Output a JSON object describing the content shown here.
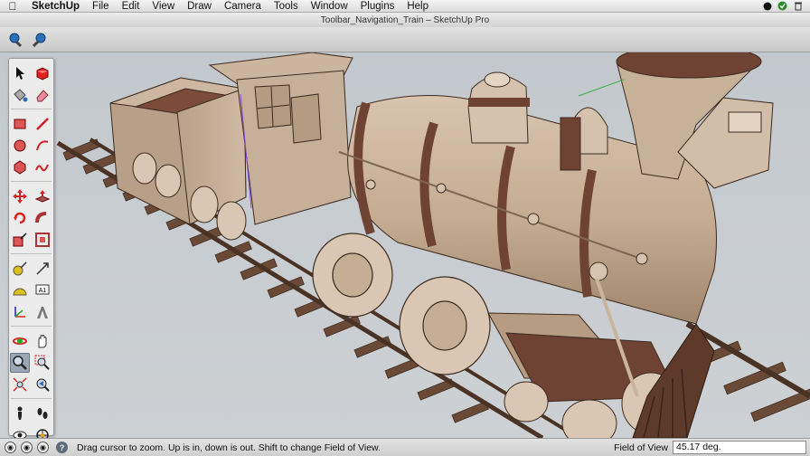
{
  "menubar": {
    "app_name": "SketchUp",
    "items": [
      "File",
      "Edit",
      "View",
      "Draw",
      "Camera",
      "Tools",
      "Window",
      "Plugins",
      "Help"
    ]
  },
  "window": {
    "title": "Toolbar_Navigation_Train – SketchUp Pro"
  },
  "toolbar": {
    "buttons": [
      "get-models-icon",
      "share-model-icon"
    ]
  },
  "palette": {
    "groups": [
      [
        "select-icon",
        "make-component-icon",
        "paint-bucket-icon",
        "eraser-icon"
      ],
      [
        "rectangle-icon",
        "line-icon",
        "circle-icon",
        "arc-icon",
        "polygon-icon",
        "freehand-icon"
      ],
      [
        "move-icon",
        "push-pull-icon",
        "rotate-icon",
        "follow-me-icon",
        "scale-icon",
        "offset-icon"
      ],
      [
        "tape-measure-icon",
        "dimension-icon",
        "protractor-icon",
        "text-icon",
        "axes-icon",
        "3d-text-icon"
      ],
      [
        "orbit-icon",
        "pan-icon",
        "zoom-icon",
        "zoom-window-icon",
        "zoom-extents-icon",
        "previous-view-icon"
      ],
      [
        "position-camera-icon",
        "walk-icon",
        "look-around-icon",
        "section-plane-icon"
      ]
    ],
    "active_tool": "zoom-icon"
  },
  "statusbar": {
    "message": "Drag cursor to zoom.  Up is in, down is out. Shift to change Field of View.",
    "fov_label": "Field of View",
    "fov_value": "45.17 deg."
  },
  "colors": {
    "wood_light": "#c6ae95",
    "wood_mid": "#b59c82",
    "wood_dark": "#6e4333",
    "rail": "#5a4030",
    "sky": "#c5cacf"
  }
}
